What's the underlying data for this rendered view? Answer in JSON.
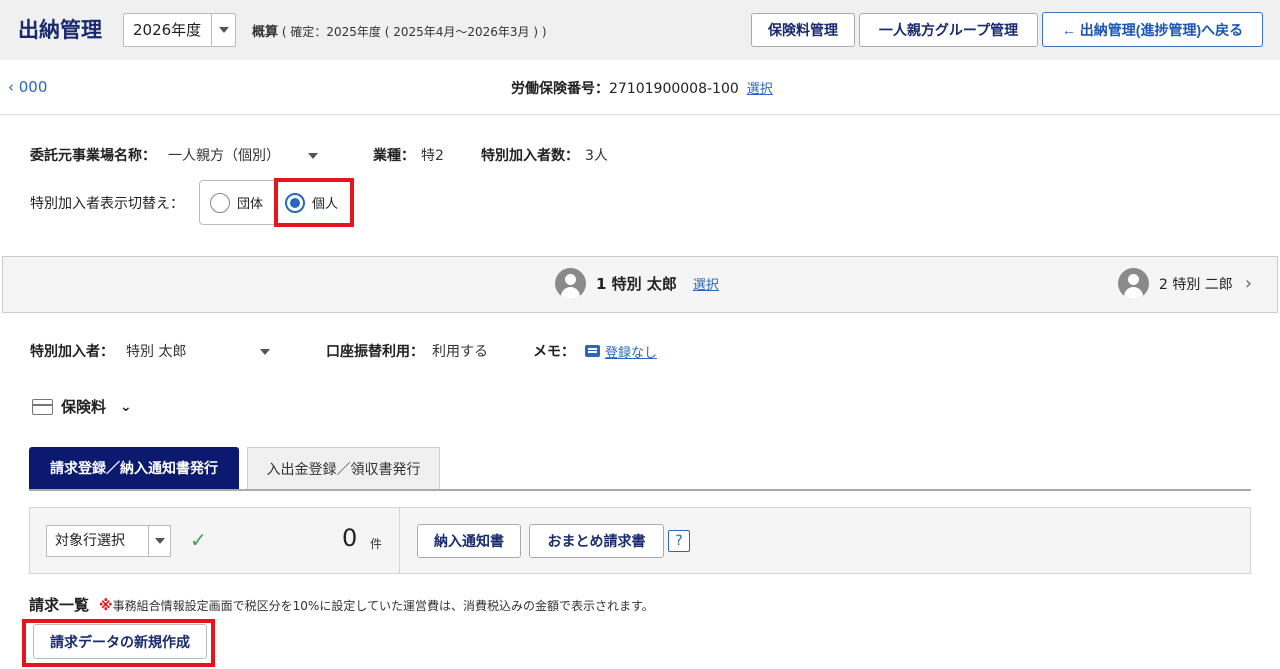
{
  "header": {
    "title": "出納管理",
    "year": "2026年度",
    "gaisan_label": "概算",
    "gaisan_detail": "( 確定：2025年度 ( 2025年4月～2026年3月 ) )",
    "buttons": {
      "hokenryo": "保険料管理",
      "group": "一人親方グループ管理",
      "back": "← 出納管理(進捗管理)へ戻る"
    }
  },
  "breadcrumb": {
    "back": "‹  000"
  },
  "rodo": {
    "label": "労働保険番号：",
    "value": "27101900008-100",
    "select_link": "選択"
  },
  "info": {
    "itaku_label": "委託元事業場名称：",
    "itaku_value": "一人親方（個別）",
    "gyoshu_label": "業種：",
    "gyoshu_value": "特2",
    "count_label": "特別加入者数：",
    "count_value": "3人"
  },
  "toggle": {
    "label": "特別加入者表示切替え：",
    "options": [
      {
        "label": "団体",
        "selected": false
      },
      {
        "label": "個人",
        "selected": true
      }
    ]
  },
  "persons": {
    "current": {
      "name": "1 特別 太郎",
      "select_link": "選択"
    },
    "next": {
      "name": "2 特別 二郎"
    }
  },
  "detail": {
    "member_label": "特別加入者：",
    "member_value": "特別 太郎",
    "koza_label": "口座振替利用：",
    "koza_value": "利用する",
    "memo_label": "メモ：",
    "memo_link": "登録なし"
  },
  "section": {
    "title": "保険料"
  },
  "tabs": [
    {
      "label": "請求登録／納入通知書発行",
      "active": true
    },
    {
      "label": "入出金登録／領収書発行",
      "active": false
    }
  ],
  "panel": {
    "row_select": "対象行選択",
    "count": "0",
    "count_unit": "件",
    "btn_nonyu": "納入通知書",
    "btn_omatome": "おまとめ請求書",
    "help": "?"
  },
  "list": {
    "title": "請求一覧",
    "note_mark": "※",
    "note": "事務組合情報設定画面で税区分を10%に設定していた運営費は、消費税込みの金額で表示されます。",
    "new_button": "請求データの新規作成"
  },
  "colors": {
    "navy": "#0b1a6e",
    "link": "#2a66c0",
    "highlight": "#e8141d"
  }
}
